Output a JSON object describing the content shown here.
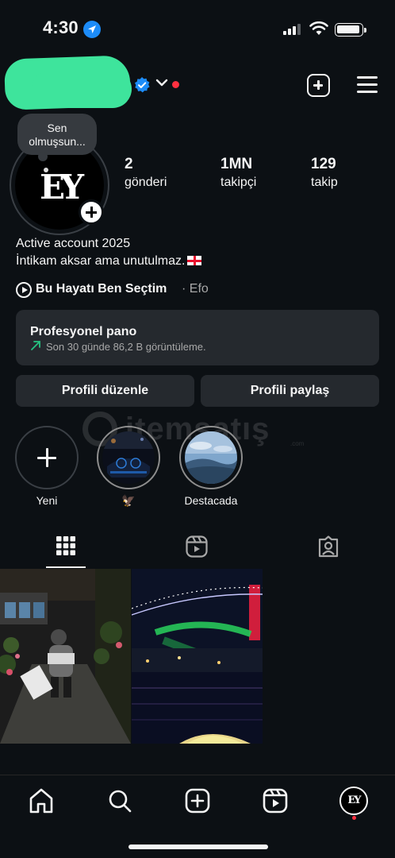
{
  "status_bar": {
    "time": "4:30"
  },
  "header": {
    "username_redacted": true
  },
  "note": {
    "text": "Sen olmuşsun..."
  },
  "avatar": {
    "logo_text": "EY"
  },
  "stats": [
    {
      "value": "2",
      "label": "gönderi"
    },
    {
      "value": "1MN",
      "label": "takipçi"
    },
    {
      "value": "129",
      "label": "takip"
    }
  ],
  "bio": {
    "line1": "Active account 2025",
    "line2": "İntikam aksar ama unutulmaz."
  },
  "music": {
    "title": "Bu Hayatı Ben Seçtim",
    "separator": "·",
    "artist": "Efo"
  },
  "dashboard": {
    "title": "Profesyonel pano",
    "subtitle": "Son 30 günde 86,2 B görüntüleme."
  },
  "buttons": {
    "edit": "Profili düzenle",
    "share": "Profili paylaş"
  },
  "watermark": {
    "text": "itemsatış",
    "sub": ".com"
  },
  "highlights": [
    {
      "label": "Yeni"
    },
    {
      "label": "🦅"
    },
    {
      "label": "Destacada"
    }
  ],
  "colors": {
    "background": "#0c1014",
    "card": "#25292e",
    "accent_verified": "#1d8cf8",
    "notification": "#ff3040",
    "trend_green": "#26c281"
  },
  "icons": [
    "location-arrow-icon",
    "signal-icon",
    "wifi-icon",
    "battery-icon",
    "verified-icon",
    "chevron-down-icon",
    "create-icon",
    "menu-icon",
    "play-icon",
    "trend-up-icon",
    "grid-icon",
    "reels-icon",
    "tagged-icon",
    "home-icon",
    "search-icon",
    "create-icon",
    "reels-icon",
    "profile-icon"
  ]
}
